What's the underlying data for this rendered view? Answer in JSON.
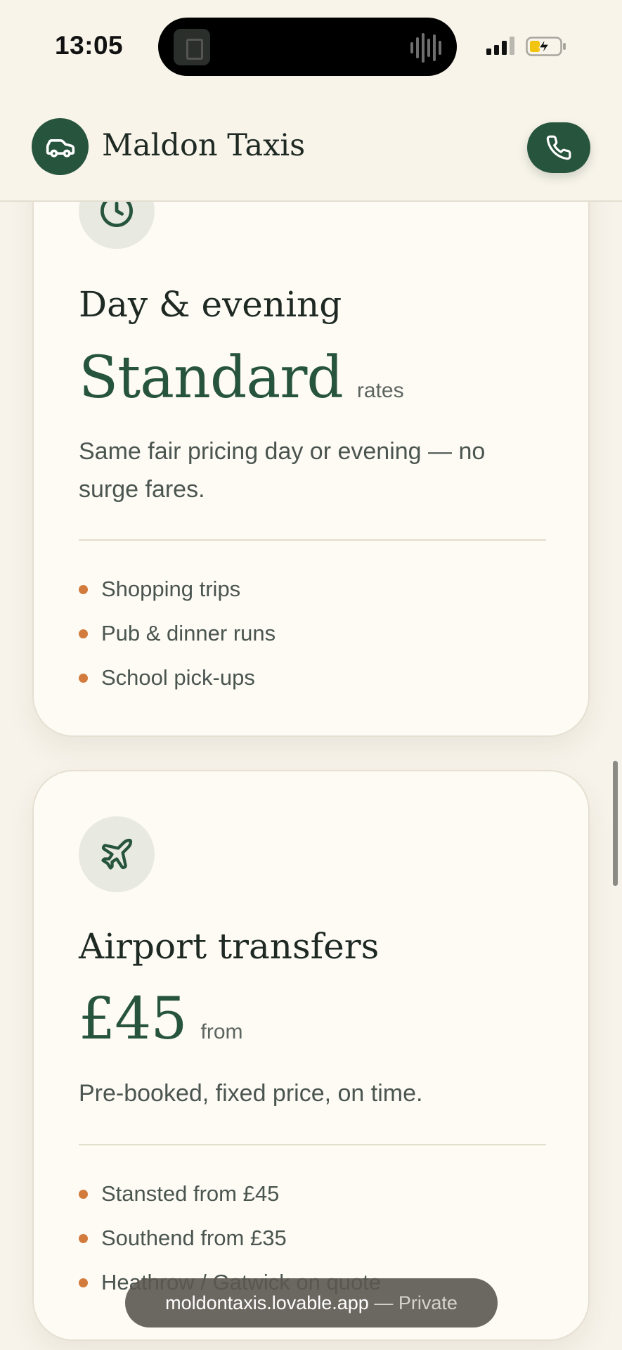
{
  "status_bar": {
    "time": "13:05"
  },
  "header": {
    "brand": "Maldon Taxis",
    "logo_icon": "car-icon",
    "call_icon": "phone-icon"
  },
  "cards": [
    {
      "icon": "clock-icon",
      "title": "Day & evening",
      "price": "Standard",
      "price_suffix": "rates",
      "description": "Same fair pricing day or evening — no surge fares.",
      "features": [
        "Shopping trips",
        "Pub & dinner runs",
        "School pick-ups"
      ]
    },
    {
      "icon": "plane-icon",
      "title": "Airport transfers",
      "price": "£45",
      "price_suffix": "from",
      "description": "Pre-booked, fixed price, on time.",
      "features": [
        "Stansted from £45",
        "Southend from £35",
        "Heathrow / Gatwick on quote"
      ]
    }
  ],
  "browser": {
    "url": "moldontaxis.lovable.app",
    "mode": "— Private"
  },
  "colors": {
    "brand_green": "#27543d",
    "accent_orange": "#d27b3c",
    "background": "#f7f3ea",
    "card": "#fefbf5"
  }
}
